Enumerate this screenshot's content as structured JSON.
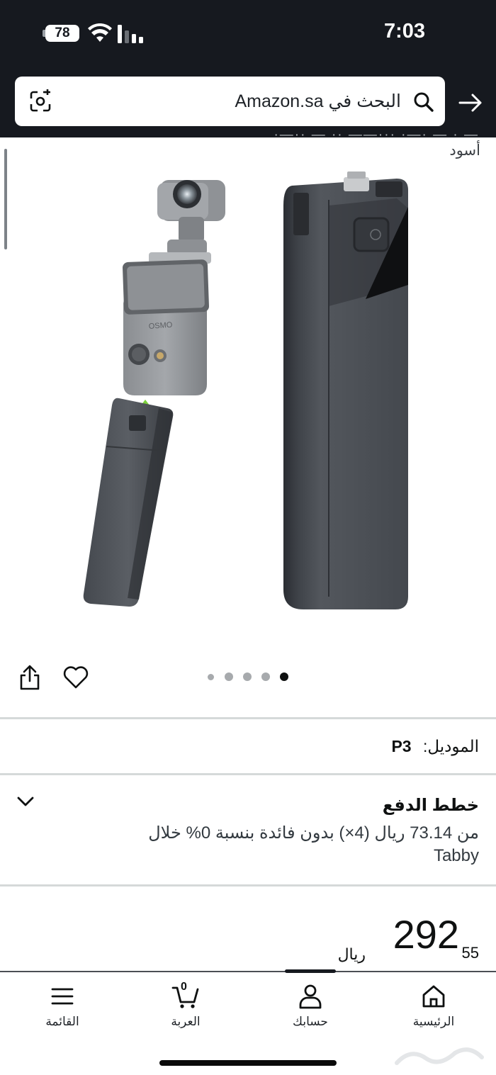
{
  "status_bar": {
    "battery": "78",
    "time": "7:03"
  },
  "search": {
    "text": "البحث في Amazon.sa"
  },
  "product": {
    "title_partial": "— · — ·—· ···—— ·· — ··—·",
    "color_line": "أسود",
    "image_count": 5,
    "active_image_index": 5
  },
  "model": {
    "label": "الموديل:",
    "value": "P3"
  },
  "payment": {
    "title": "خطط الدفع",
    "description": "من 73.14 ريال (4×) بدون فائدة بنسبة 0% خلال Tabby"
  },
  "price": {
    "whole": "292",
    "fraction": "55",
    "currency": "ريال"
  },
  "bottom_nav": {
    "home": "الرئيسية",
    "account": "حسابك",
    "cart": "العربة",
    "cart_count": "0",
    "menu": "القائمة"
  },
  "colors": {
    "header_bg": "#16191f",
    "divider": "#d5d9d9",
    "active_dot": "#0f1111"
  }
}
